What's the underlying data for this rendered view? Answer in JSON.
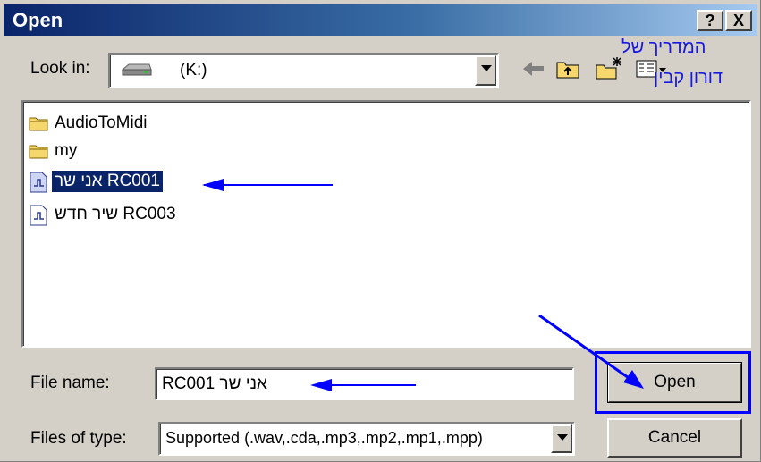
{
  "window": {
    "title": "Open",
    "help_label": "?",
    "close_label": "X"
  },
  "look_in": {
    "label": "Look in:",
    "value": "(K:)"
  },
  "watermark": {
    "line1": "המדריך של",
    "line2": "דורון קבין"
  },
  "files": [
    {
      "name": "AudioToMidi",
      "type": "folder",
      "selected": false
    },
    {
      "name": "my",
      "type": "folder",
      "selected": false
    },
    {
      "name": "RC001 אני שר",
      "type": "audio",
      "selected": true
    },
    {
      "name": "RC003 שיר חדש",
      "type": "audio",
      "selected": false
    }
  ],
  "file_name": {
    "label": "File name:",
    "value": "RC001 אני שר"
  },
  "file_type": {
    "label": "Files of type:",
    "value": "Supported (.wav,.cda,.mp3,.mp2,.mp1,.mpp)"
  },
  "buttons": {
    "open": "Open",
    "cancel": "Cancel"
  },
  "annotation_color": "#0000ff"
}
